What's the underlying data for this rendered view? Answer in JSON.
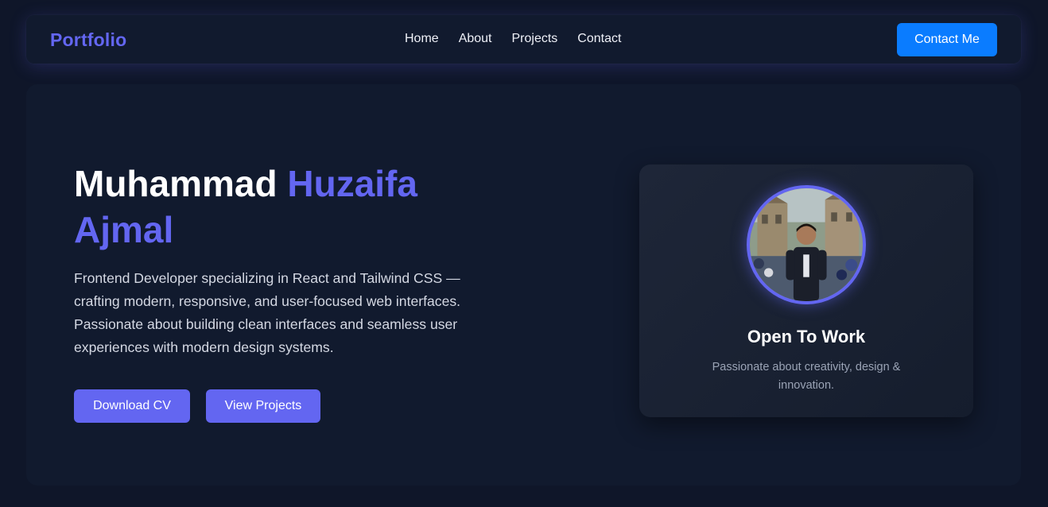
{
  "navbar": {
    "brand": "Portfolio",
    "links": [
      "Home",
      "About",
      "Projects",
      "Contact"
    ],
    "cta_label": "Contact Me"
  },
  "hero": {
    "name_first": "Muhammad ",
    "name_accent": "Huzaifa Ajmal",
    "description": "Frontend Developer specializing in React and Tailwind CSS — crafting modern, responsive, and user-focused web interfaces. Passionate about building clean interfaces and seamless user experiences with modern design systems.",
    "download_cv_label": "Download CV",
    "view_projects_label": "View Projects"
  },
  "profile_card": {
    "title": "Open To Work",
    "subtitle": "Passionate about creativity, design & innovation."
  },
  "colors": {
    "background": "#0f1629",
    "surface": "#111a2e",
    "accent": "#6366f1",
    "cta_blue": "#0a7cff"
  }
}
